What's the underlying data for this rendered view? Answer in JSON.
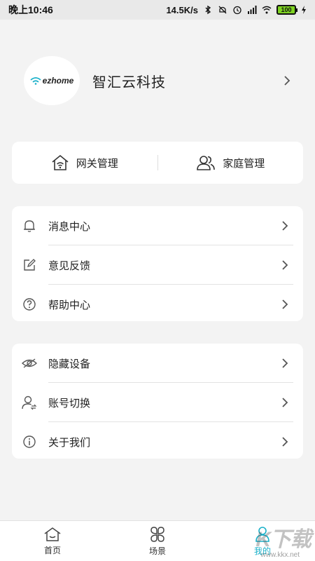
{
  "status_bar": {
    "time": "晚上10:46",
    "net_speed": "14.5K/s",
    "battery": "100"
  },
  "profile": {
    "logo_text": "ezhome",
    "name": "智汇云科技"
  },
  "quick_actions": [
    {
      "label": "网关管理",
      "icon": "home-wifi-icon"
    },
    {
      "label": "家庭管理",
      "icon": "users-icon"
    }
  ],
  "menu_group_1": [
    {
      "label": "消息中心",
      "icon": "bell-icon"
    },
    {
      "label": "意见反馈",
      "icon": "edit-icon"
    },
    {
      "label": "帮助中心",
      "icon": "help-icon"
    }
  ],
  "menu_group_2": [
    {
      "label": "隐藏设备",
      "icon": "eye-off-icon"
    },
    {
      "label": "账号切换",
      "icon": "account-switch-icon"
    },
    {
      "label": "关于我们",
      "icon": "info-icon"
    }
  ],
  "tabbar": {
    "tabs": [
      {
        "label": "首页",
        "icon": "home-icon",
        "active": false
      },
      {
        "label": "场景",
        "icon": "scene-icon",
        "active": false
      },
      {
        "label": "我的",
        "icon": "profile-icon",
        "active": true
      }
    ],
    "accent": "#19b0c9"
  },
  "watermark": {
    "text": "K下载",
    "url": "www.kkx.net"
  }
}
